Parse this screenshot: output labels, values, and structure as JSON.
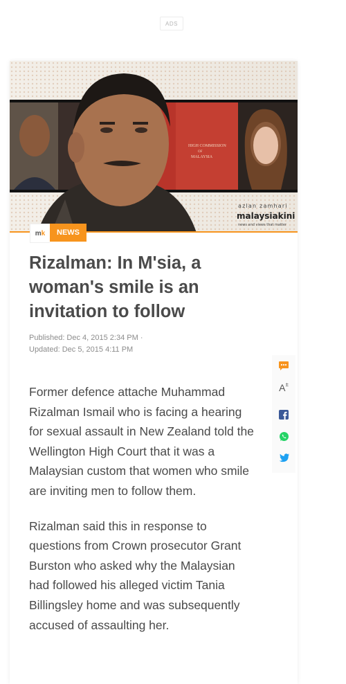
{
  "ads": {
    "label": "ADS"
  },
  "hero": {
    "image_alt": "Rizalman photo collage",
    "commission_text_1": "HIGH COMMISSION",
    "commission_text_2": "OF",
    "commission_text_3": "MALAYSIA",
    "credit_name": "azlan zamhari",
    "brand": "malaysiakini",
    "brand_tagline": "news and views that matter"
  },
  "tags": {
    "logo_m": "m",
    "logo_k": "k",
    "category": "NEWS"
  },
  "article": {
    "title": "Rizalman: In M'sia, a woman's smile is an invitation to follow",
    "published": "Published:  Dec 4, 2015 2:34 PM  ·",
    "updated": "Updated: Dec 5, 2015 4:11 PM",
    "paragraphs": [
      "Former defence attache Muhammad Rizalman Ismail who is facing a hearing for sexual assault in New Zealand told the Wellington High Court that it was a Malaysian custom that women who smile are inviting men to follow them.",
      "Rizalman said this in response to questions from Crown prosecutor Grant Burston who asked why the Malaysian had followed his alleged victim Tania Billingsley home and was subsequently accused of assaulting her."
    ]
  },
  "share": {
    "font_size_label": "A",
    "items": [
      "comment-icon",
      "font-size-icon",
      "facebook-icon",
      "whatsapp-icon",
      "twitter-icon"
    ]
  },
  "colors": {
    "accent": "#f7941d",
    "facebook": "#3b5998",
    "whatsapp": "#25d366",
    "twitter": "#1da1f2",
    "text": "#4a4a4a"
  }
}
